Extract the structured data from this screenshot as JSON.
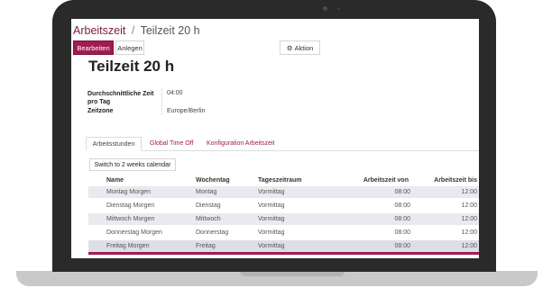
{
  "breadcrumb": {
    "parent": "Arbeitszeit",
    "separator": "/",
    "current": "Teilzeit 20 h"
  },
  "toolbar": {
    "edit_label": "Bearbeiten",
    "create_label": "Anlegen",
    "action_label": "Aktion"
  },
  "record": {
    "title": "Teilzeit 20 h",
    "fields": {
      "avg_hours_label_line1": "Durchschnittliche Zeit",
      "avg_hours_label_line2": "pro Tag",
      "avg_hours_value": "04:00",
      "timezone_label": "Zeitzone",
      "timezone_value": "Europe/Berlin"
    }
  },
  "tabs": [
    {
      "label": "Arbeitsstunden",
      "active": true
    },
    {
      "label": "Global Time Off",
      "active": false
    },
    {
      "label": "Konfiguration Arbeitszeit",
      "active": false
    }
  ],
  "switch_button": "Switch to 2 weeks calendar",
  "table": {
    "headers": [
      "Name",
      "Wochentag",
      "Tageszeitraum",
      "Arbeitszeit von",
      "Arbeitszeit bis"
    ],
    "rows": [
      [
        "Montag Morgen",
        "Montag",
        "Vormittag",
        "08:00",
        "12:00"
      ],
      [
        "Dienstag Morgen",
        "Dienstag",
        "Vormittag",
        "08:00",
        "12:00"
      ],
      [
        "Mittwoch Morgen",
        "Mittwoch",
        "Vormittag",
        "08:00",
        "12:00"
      ],
      [
        "Donnerstag Morgen",
        "Donnerstag",
        "Vormittag",
        "08:00",
        "12:00"
      ],
      [
        "Freitag Morgen",
        "Freitag",
        "Vormittag",
        "08:00",
        "12:00"
      ]
    ]
  },
  "colors": {
    "accent": "#a01b52",
    "breadcrumb": "#7c1b43",
    "row_shade": "#e9e9ef"
  },
  "icons": {
    "action": "gear-icon"
  }
}
